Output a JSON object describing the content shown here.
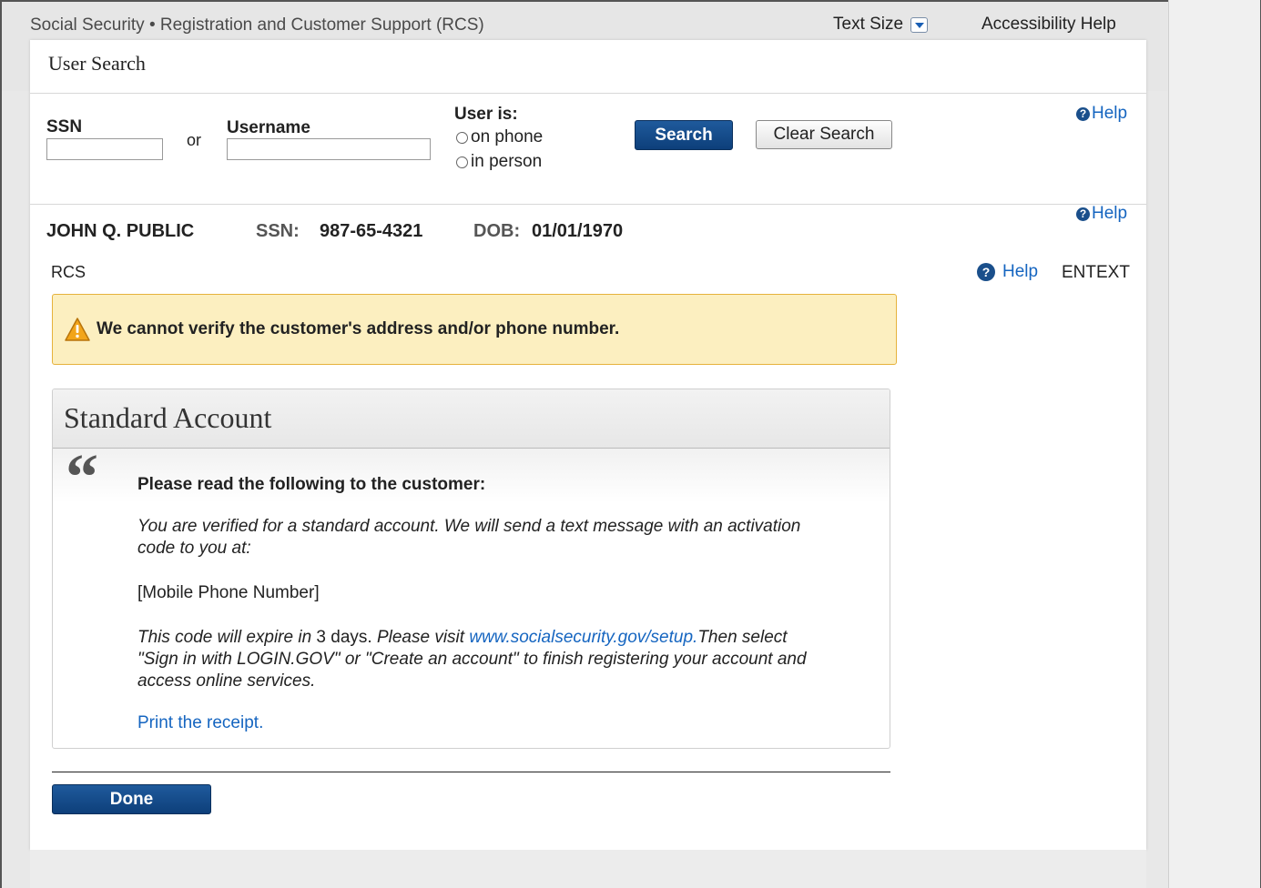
{
  "header": {
    "app_title": "Social Security • Registration and Customer Support (RCS)",
    "text_size_label": "Text Size",
    "accessibility_help": "Accessibility Help"
  },
  "panel": {
    "title": "User Search"
  },
  "search": {
    "ssn_label": "SSN",
    "or_text": "or",
    "username_label": "Username",
    "ssn_value": "",
    "username_value": "",
    "user_is_label": "User is:",
    "options": [
      "on phone",
      "in person"
    ],
    "search_button": "Search",
    "clear_button": "Clear Search",
    "help_label": "Help"
  },
  "user": {
    "name": "JOHN Q. PUBLIC",
    "ssn_label": "SSN:",
    "ssn": "987-65-4321",
    "dob_label": "DOB:",
    "dob": "01/01/1970",
    "help_label": "Help"
  },
  "rcs": {
    "label": "RCS",
    "help_label": "Help",
    "entext": "ENTEXT"
  },
  "warning": {
    "message": "We cannot verify the customer's address and/or phone number."
  },
  "account": {
    "title": "Standard Account",
    "quote_mark": "“",
    "instruction": "Please read the following to the customer:",
    "verified_text": "You are verified for a standard account. We will send a text message with an activation code to you at:",
    "mobile_placeholder": "[Mobile Phone Number]",
    "expire_part1": "This code will expire in",
    "expire_days": " 3 days.",
    "expire_part2": " Please visit ",
    "setup_link": "www.socialsecurity.gov/setup.",
    "expire_part3": "Then select \"Sign in with LOGIN.GOV\" or \"Create an account\" to finish registering your account and access online services.",
    "print_link": "Print the receipt."
  },
  "actions": {
    "done_button": "Done"
  },
  "colors": {
    "primary_button": "#0d3f7a",
    "link": "#1565c0",
    "warning_bg": "#fcefc0",
    "warning_border": "#e6b23c"
  }
}
